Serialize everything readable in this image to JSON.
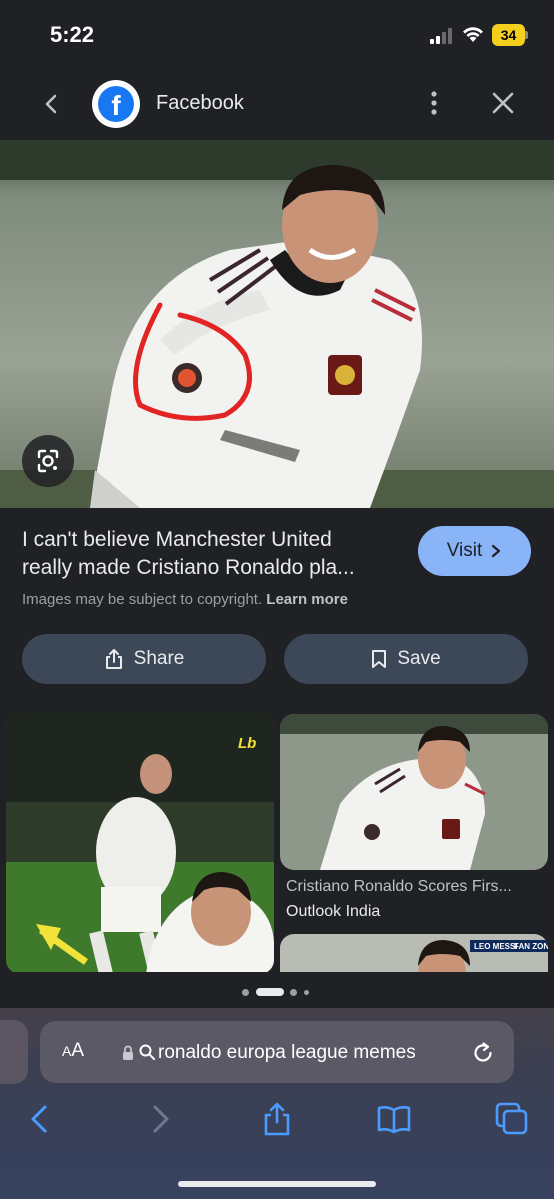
{
  "status_bar": {
    "time": "5:22",
    "battery": "34",
    "battery_color": "#f5cf1d"
  },
  "header": {
    "site_name": "Facebook",
    "logo_letter": "f",
    "icons": [
      "back-chevron-icon",
      "facebook-logo-icon",
      "more-vertical-icon",
      "close-icon"
    ]
  },
  "image_result": {
    "title_line1": "I can't believe Manchester United",
    "title_line2": "really made Cristiano Ronaldo pla...",
    "visit_label": "Visit",
    "copyright_text": "Images may be subject to copyright.",
    "learn_more_label": "Learn more",
    "share_label": "Share",
    "save_label": "Save"
  },
  "related": {
    "left_badge": "Lb",
    "items": [
      {
        "title": "Cristiano Ronaldo Scores Firs...",
        "source": "Outlook India"
      }
    ],
    "partial_badge_1": "LEO MESSI",
    "partial_badge_2": "FAN ZONE"
  },
  "browser": {
    "aa_big": "A",
    "aa_small": "A",
    "url_text": "ronaldo europa league memes",
    "accent_color": "#4b9cff"
  }
}
